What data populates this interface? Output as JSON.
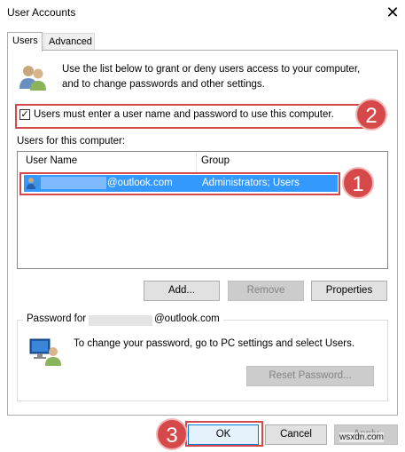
{
  "window": {
    "title": "User Accounts",
    "close_glyph": "✕"
  },
  "tabs": [
    {
      "label": "Users",
      "active": true
    },
    {
      "label": "Advanced",
      "active": false
    }
  ],
  "intro": {
    "line1": "Use the list below to grant or deny users access to your computer,",
    "line2": "and to change passwords and other settings.",
    "icon": "users-icon"
  },
  "require_login": {
    "label": "Users must enter a user name and password to use this computer.",
    "checked": true,
    "check_glyph": "✓"
  },
  "users_list": {
    "caption": "Users for this computer:",
    "columns": [
      "User Name",
      "Group"
    ],
    "rows": [
      {
        "user_suffix": "@outlook.com",
        "group": "Administrators; Users",
        "selected": true
      }
    ]
  },
  "buttons": {
    "add": "Add...",
    "remove": "Remove",
    "properties": "Properties",
    "reset_password": "Reset Password...",
    "ok": "OK",
    "cancel": "Cancel",
    "apply": "Apply"
  },
  "password_group": {
    "label_prefix": "Password for",
    "label_suffix": "@outlook.com",
    "text": "To change your password, go to PC settings and select Users."
  },
  "annotations": {
    "badge1": "1",
    "badge2": "2",
    "badge3": "3"
  },
  "watermark": "wsxdn.com",
  "colors": {
    "accent_red": "#d6494a",
    "selection_blue": "#3399ff",
    "ok_border": "#0078d7"
  }
}
